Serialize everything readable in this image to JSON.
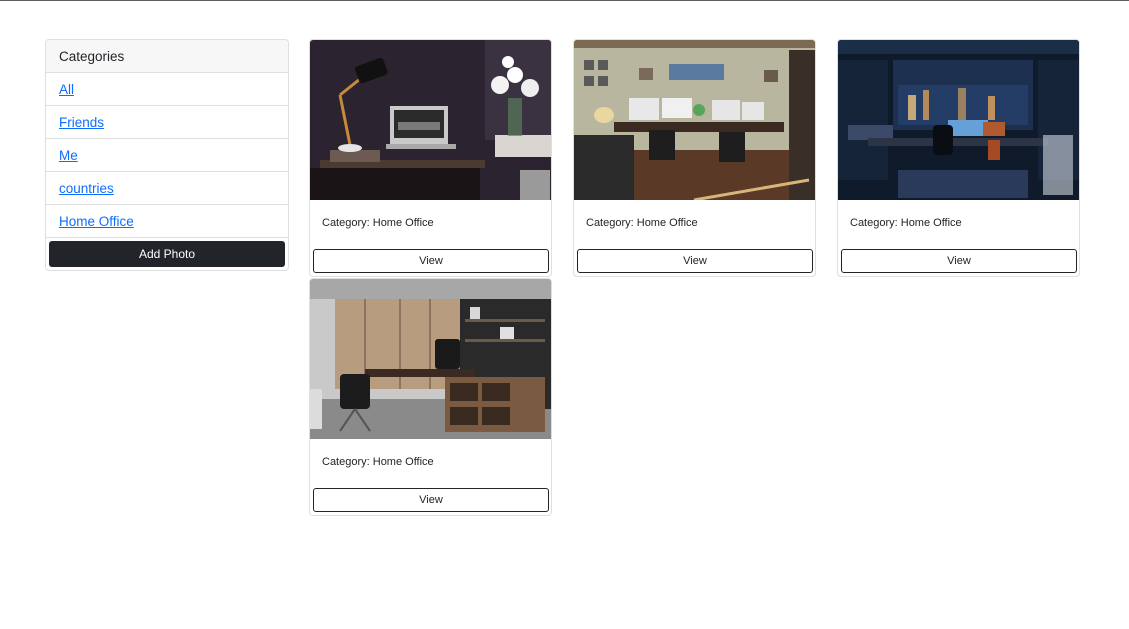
{
  "sidebar": {
    "header": "Categories",
    "items": [
      {
        "label": "All"
      },
      {
        "label": "Friends"
      },
      {
        "label": "Me"
      },
      {
        "label": "countries"
      },
      {
        "label": "Home Office"
      }
    ],
    "add_photo_label": "Add Photo"
  },
  "photos": [
    {
      "category_text": "Category: Home Office",
      "view_label": "View"
    },
    {
      "category_text": "Category: Home Office",
      "view_label": "View"
    },
    {
      "category_text": "Category: Home Office",
      "view_label": "View"
    },
    {
      "category_text": "Category: Home Office",
      "view_label": "View"
    }
  ],
  "colors": {
    "link": "#0d6efd",
    "dark_button": "#212529",
    "border": "#dfdfdf"
  }
}
